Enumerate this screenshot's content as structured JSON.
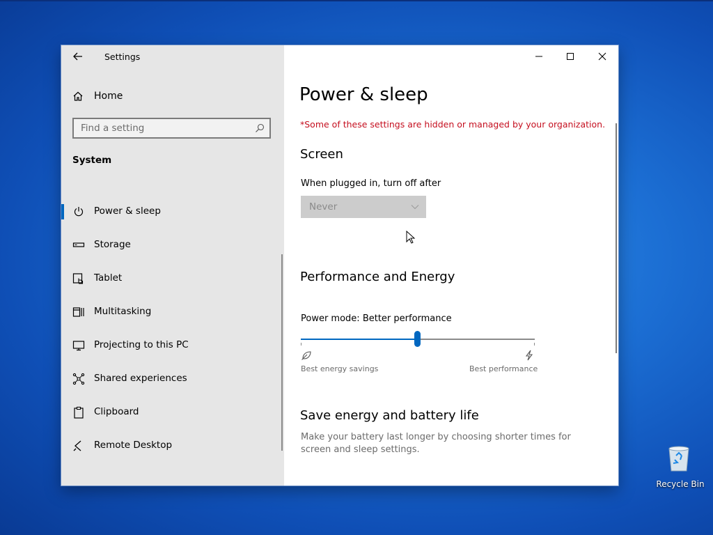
{
  "window": {
    "app_title": "Settings",
    "controls": {
      "minimize": "minimize",
      "maximize": "maximize",
      "close": "close"
    }
  },
  "sidebar": {
    "home_label": "Home",
    "search_placeholder": "Find a setting",
    "section_label": "System",
    "items": [
      {
        "label": "Power & sleep",
        "icon": "power-icon",
        "active": true
      },
      {
        "label": "Storage",
        "icon": "storage-icon",
        "active": false
      },
      {
        "label": "Tablet",
        "icon": "tablet-icon",
        "active": false
      },
      {
        "label": "Multitasking",
        "icon": "multitasking-icon",
        "active": false
      },
      {
        "label": "Projecting to this PC",
        "icon": "projecting-icon",
        "active": false
      },
      {
        "label": "Shared experiences",
        "icon": "shared-experiences-icon",
        "active": false
      },
      {
        "label": "Clipboard",
        "icon": "clipboard-icon",
        "active": false
      },
      {
        "label": "Remote Desktop",
        "icon": "remote-desktop-icon",
        "active": false
      }
    ]
  },
  "main": {
    "title": "Power & sleep",
    "org_warning": "*Some of these settings are hidden or managed by your organization.",
    "screen": {
      "heading": "Screen",
      "plugged_label": "When plugged in, turn off after",
      "plugged_value": "Never"
    },
    "performance": {
      "heading": "Performance and Energy",
      "power_mode_label": "Power mode: Better performance",
      "slider_level": 0.5,
      "left_caption": "Best energy savings",
      "right_caption": "Best performance"
    },
    "battery": {
      "heading": "Save energy and battery life",
      "description": "Make your battery last longer by choosing shorter times for screen and sleep settings."
    }
  },
  "desktop": {
    "recycle_bin_label": "Recycle Bin"
  },
  "colors": {
    "accent": "#0067c0",
    "warning": "#c50f1f",
    "sidebar_bg": "#e6e6e6"
  }
}
